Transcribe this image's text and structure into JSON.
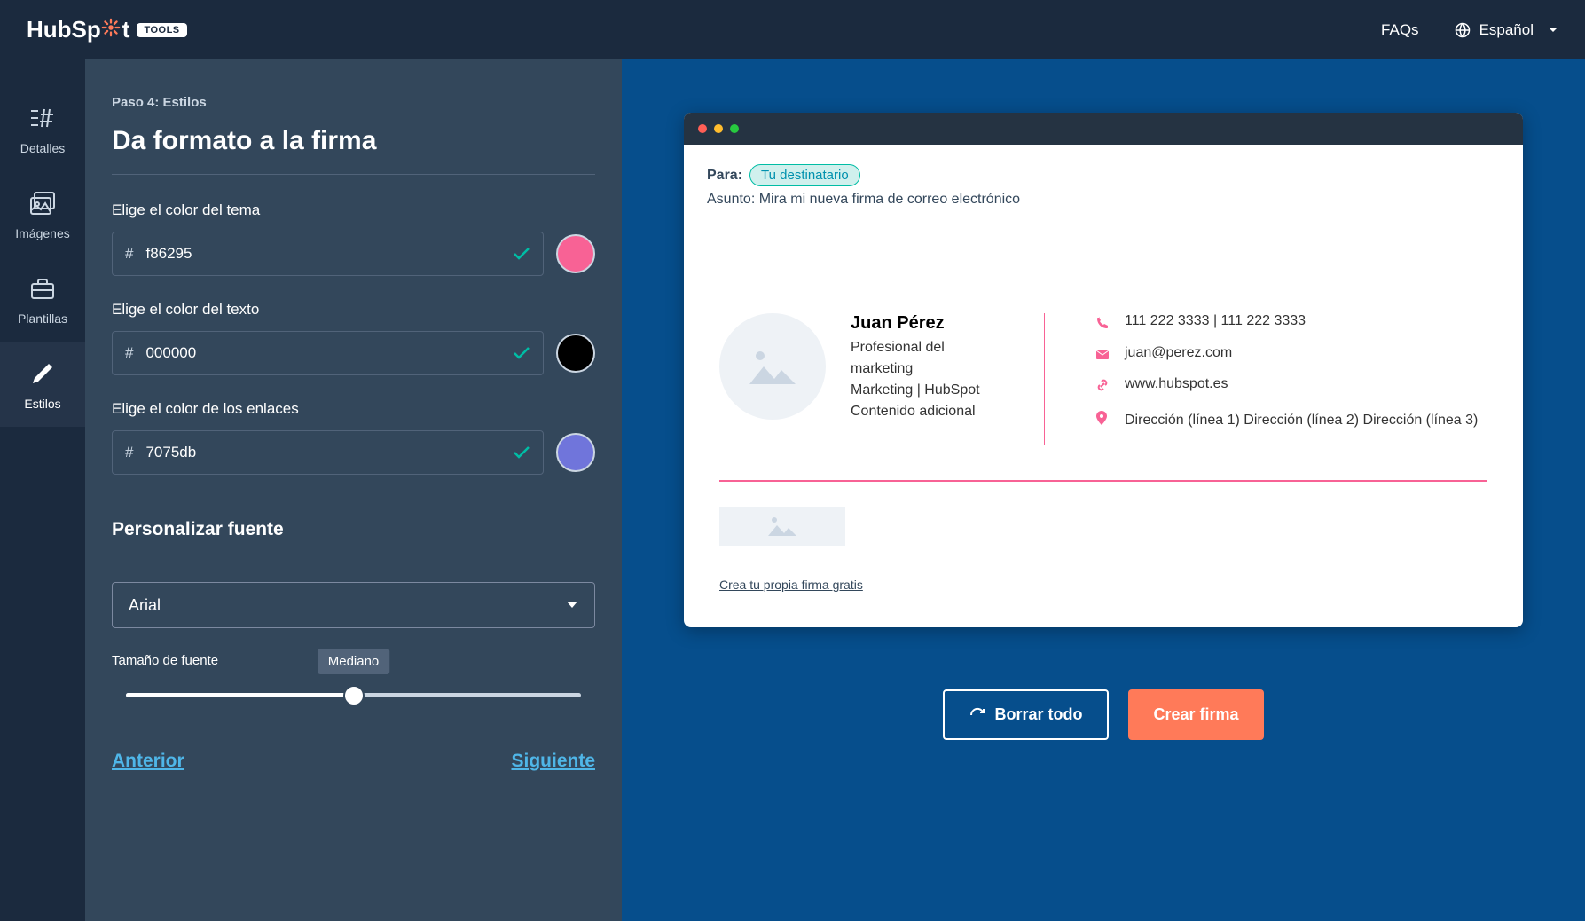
{
  "header": {
    "brand_prefix": "HubSp",
    "brand_suffix": "t",
    "tools_badge": "TOOLS",
    "faqs": "FAQs",
    "language": "Español"
  },
  "sidebar": {
    "items": [
      {
        "label": "Detalles",
        "icon": "text-lines"
      },
      {
        "label": "Imágenes",
        "icon": "images"
      },
      {
        "label": "Plantillas",
        "icon": "briefcase"
      },
      {
        "label": "Estilos",
        "icon": "pencil"
      }
    ]
  },
  "form": {
    "step": "Paso 4: Estilos",
    "title": "Da formato a la firma",
    "theme_color_label": "Elige el color del tema",
    "theme_color": "f86295",
    "theme_color_hex": "#f86295",
    "text_color_label": "Elige el color del texto",
    "text_color": "000000",
    "text_color_hex": "#000000",
    "link_color_label": "Elige el color de los enlaces",
    "link_color": "7075db",
    "link_color_hex": "#7075db",
    "font_section": "Personalizar fuente",
    "font_value": "Arial",
    "size_label": "Tamaño de fuente",
    "size_value": "Mediano",
    "prev": "Anterior",
    "next": "Siguiente"
  },
  "preview": {
    "to_label": "Para:",
    "to_pill": "Tu destinatario",
    "subject_prefix": "Asunto: ",
    "subject": "Mira mi nueva firma de correo electrónico",
    "signature": {
      "name": "Juan Pérez",
      "line1": "Profesional del marketing",
      "line2": "Marketing | HubSpot",
      "line3": "Contenido adicional",
      "phone": "111 222 3333 | 111 222 3333",
      "email": "juan@perez.com",
      "web": "www.hubspot.es",
      "address": "Dirección (línea 1) Dirección (línea 2) Dirección (línea 3)"
    },
    "create_link": "Crea tu propia firma gratis"
  },
  "actions": {
    "clear": "Borrar todo",
    "create": "Crear firma"
  }
}
